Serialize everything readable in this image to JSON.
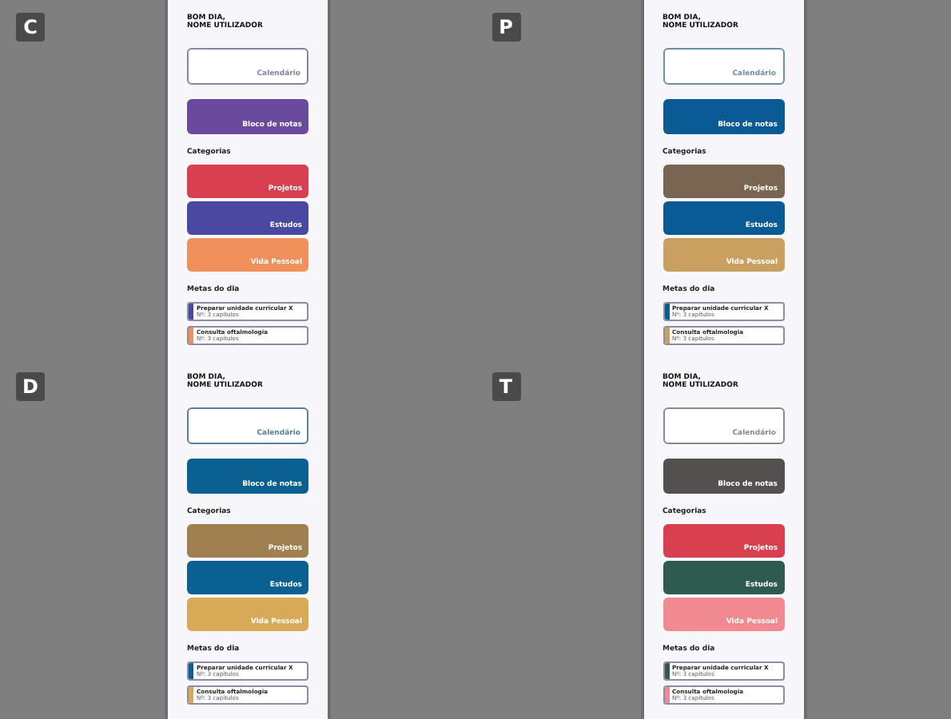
{
  "variants": [
    {
      "badge": "C",
      "greeting": "BOM DIA,",
      "user": "NOME UTILIZADOR",
      "calendar": {
        "label": "Calendário",
        "color": "#8a80a8"
      },
      "notes": {
        "label": "Bloco de notas",
        "color": "#6a4a9c"
      },
      "categories_title": "Categorias",
      "categories": [
        {
          "label": "Projetos",
          "color": "#d8404f"
        },
        {
          "label": "Estudos",
          "color": "#4a48a0"
        },
        {
          "label": "Vida Pessoal",
          "color": "#f0905a"
        }
      ],
      "goals_title": "Metas do dia",
      "goals": [
        {
          "title": "Preparar unidade curricular X",
          "detail": "Nº: 3 capítulos",
          "color": "#4a48a0"
        },
        {
          "title": "Consulta oftalmologia",
          "detail": "Nº: 3 capítulos",
          "color": "#f0905a"
        }
      ]
    },
    {
      "badge": "P",
      "greeting": "BOM DIA,",
      "user": "NOME UTILIZADOR",
      "calendar": {
        "label": "Calendário",
        "color": "#6a90a8"
      },
      "notes": {
        "label": "Bloco de notas",
        "color": "#0a5a96"
      },
      "categories_title": "Categorias",
      "categories": [
        {
          "label": "Projetos",
          "color": "#7a6550"
        },
        {
          "label": "Estudos",
          "color": "#0a5a96"
        },
        {
          "label": "Vida Pessoal",
          "color": "#c9a060"
        }
      ],
      "goals_title": "Metas do dia",
      "goals": [
        {
          "title": "Preparar unidade curricular X",
          "detail": "Nº: 3 capítulos",
          "color": "#0a5a96"
        },
        {
          "title": "Consulta oftalmologia",
          "detail": "Nº: 3 capítulos",
          "color": "#c9a060"
        }
      ]
    },
    {
      "badge": "D",
      "greeting": "BOM DIA,",
      "user": "NOME UTILIZADOR",
      "calendar": {
        "label": "Calendário",
        "color": "#5a80a0"
      },
      "notes": {
        "label": "Bloco de notas",
        "color": "#0a6090"
      },
      "categories_title": "Categorias",
      "categories": [
        {
          "label": "Projetos",
          "color": "#a08050"
        },
        {
          "label": "Estudos",
          "color": "#0a6090"
        },
        {
          "label": "Vida Pessoal",
          "color": "#d8aa58"
        }
      ],
      "goals_title": "Metas do dia",
      "goals": [
        {
          "title": "Preparar unidade curricular X",
          "detail": "Nº: 3 capítulos",
          "color": "#0a6090"
        },
        {
          "title": "Consulta oftalmologia",
          "detail": "Nº: 3 capítulos",
          "color": "#d8aa58"
        }
      ]
    },
    {
      "badge": "T",
      "greeting": "BOM DIA,",
      "user": "NOME UTILIZADOR",
      "calendar": {
        "label": "Calendário",
        "color": "#8a8a8a"
      },
      "notes": {
        "label": "Bloco de notas",
        "color": "#555050"
      },
      "categories_title": "Categorias",
      "categories": [
        {
          "label": "Projetos",
          "color": "#d84050"
        },
        {
          "label": "Estudos",
          "color": "#2e5a50"
        },
        {
          "label": "Vida Pessoal",
          "color": "#f08a90"
        }
      ],
      "goals_title": "Metas do dia",
      "goals": [
        {
          "title": "Preparar unidade curricular X",
          "detail": "Nº: 3 capítulos",
          "color": "#2e5a50"
        },
        {
          "title": "Consulta oftalmologia",
          "detail": "Nº: 3 capítulos",
          "color": "#f08a90"
        }
      ]
    }
  ]
}
